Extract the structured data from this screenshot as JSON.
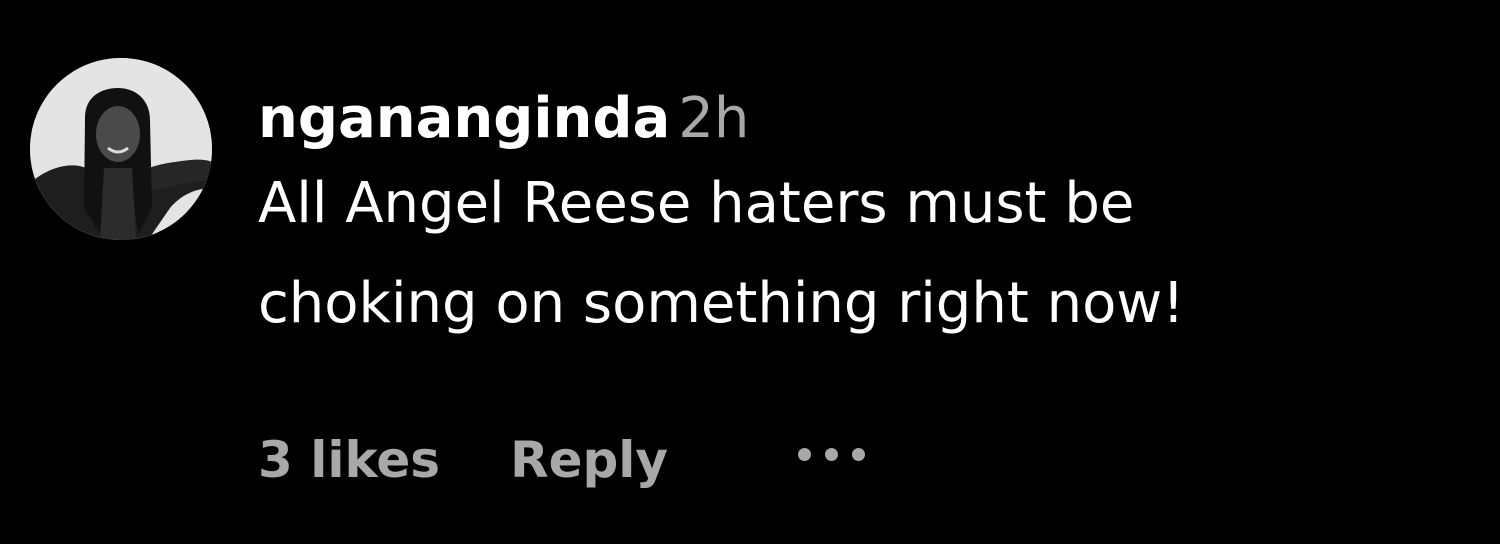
{
  "comment": {
    "username": "ngananginda",
    "timestamp": "2h",
    "text_lines": [
      "All Angel Reese haters must be",
      "choking on something right now!"
    ],
    "likes": "3 likes",
    "reply_label": "Reply",
    "more_icon": "more-horizontal-icon"
  },
  "colors": {
    "background": "#000000",
    "primary_text": "#ffffff",
    "secondary_text": "#a8a8a8"
  }
}
